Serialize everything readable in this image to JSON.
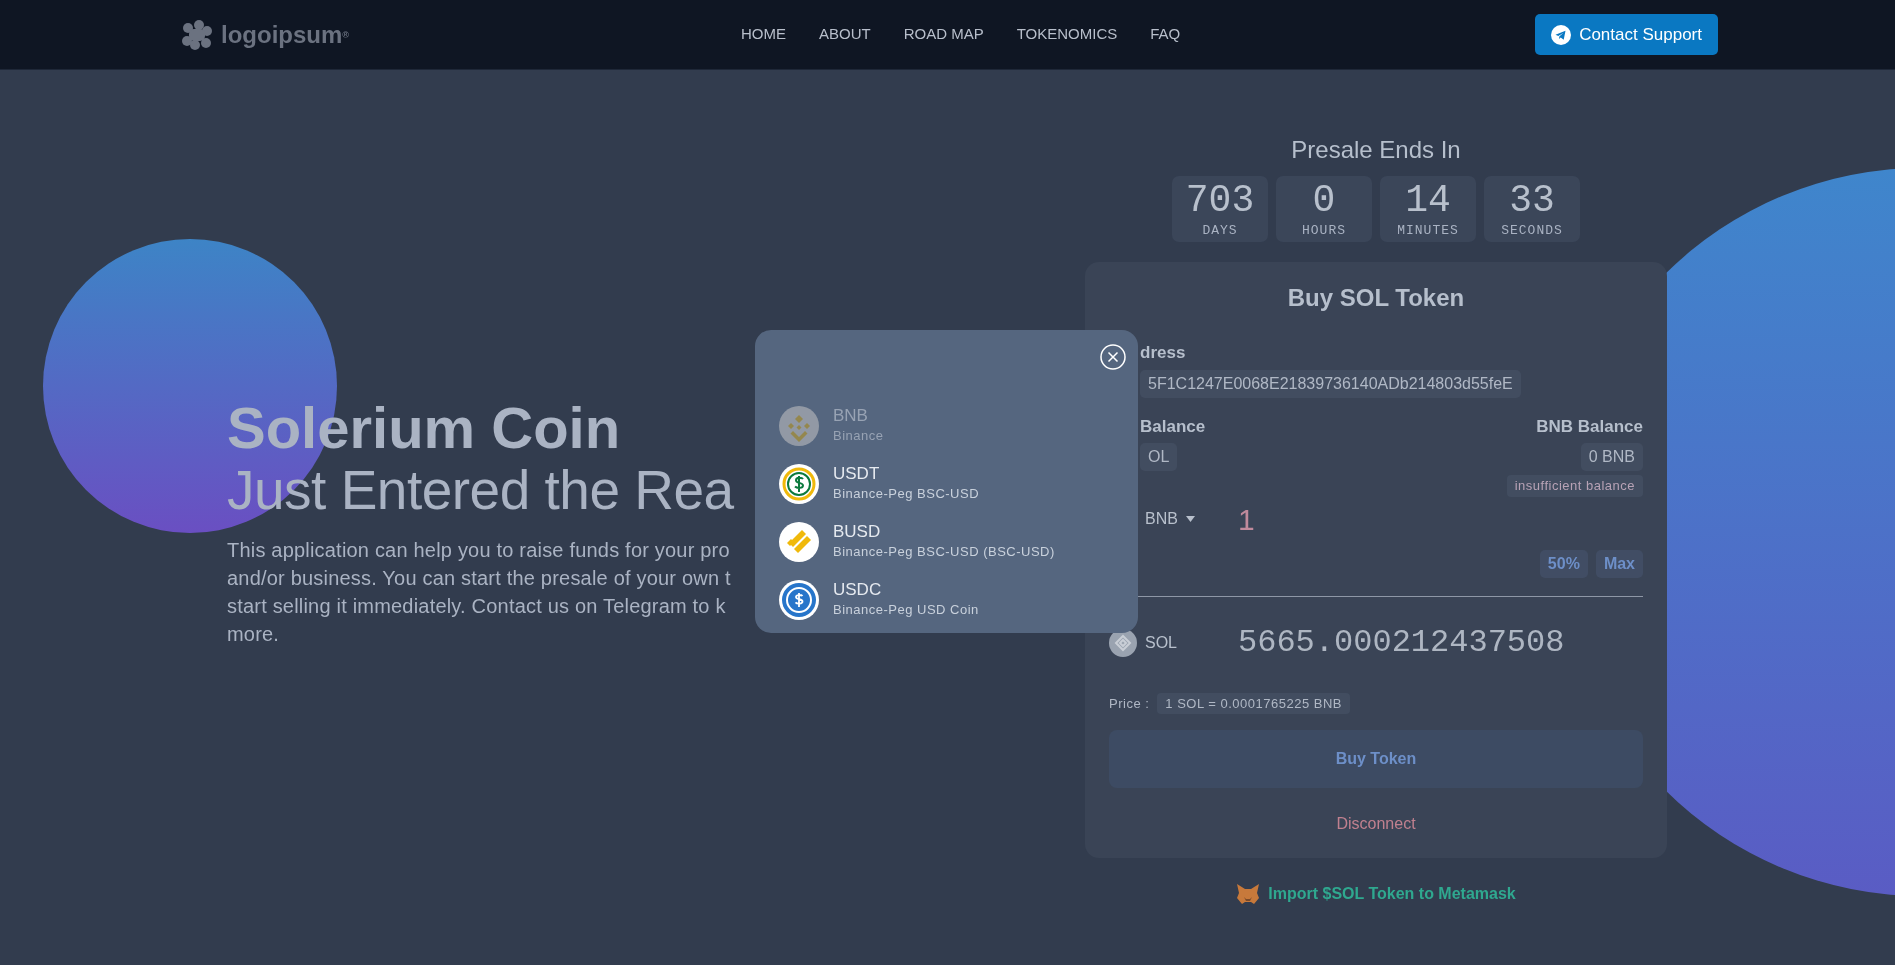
{
  "navbar": {
    "logo": "logoipsum$^{®}$",
    "links": [
      {
        "label": "HOME"
      },
      {
        "label": "ABOUT"
      },
      {
        "label": "ROAD MAP"
      },
      {
        "label": "TOKENOMICS"
      },
      {
        "label": "FAQ"
      }
    ],
    "contact_button": "Contact Support"
  },
  "hero": {
    "title": "Solerium Coin",
    "subtitle": "Just Entered the Rea",
    "description_lines": [
      "This application can help you to raise funds for your pro",
      "and/or business. You can start the presale of your own t",
      "start selling it immediately. Contact us on Telegram to k",
      "more."
    ]
  },
  "presale": {
    "title": "Presale Ends In",
    "countdown": [
      {
        "value": "703",
        "unit": "DAYS"
      },
      {
        "value": "0",
        "unit": "HOURS"
      },
      {
        "value": "14",
        "unit": "MINUTES"
      },
      {
        "value": "33",
        "unit": "SECONDS"
      }
    ]
  },
  "buy_card": {
    "title": "Buy SOL Token",
    "address_label": "dress",
    "address": "5F1C1247E0068E21839736140ADb214803d55feE",
    "sol_balance_label": "Balance",
    "sol_balance": "OL",
    "bnb_balance_label": "BNB Balance",
    "bnb_balance": "0 BNB",
    "balance_warning": "insufficient balance",
    "pay_currency": "BNB",
    "pay_amount": "1",
    "quick_amounts": [
      "50%",
      "Max"
    ],
    "receive_currency": "SOL",
    "receive_amount": "5665.000212437508",
    "price_label": "Price :",
    "price": "1 SOL = 0.0001765225 BNB",
    "buy_button": "Buy Token",
    "disconnect": "Disconnect"
  },
  "import_link": "Import $SOL Token to Metamask",
  "token_modal": {
    "tokens": [
      {
        "kind": "bnb",
        "symbol": "BNB",
        "name": "Binance",
        "selected": true
      },
      {
        "kind": "usdt",
        "symbol": "USDT",
        "name": "Binance-Peg BSC-USD",
        "selected": false
      },
      {
        "kind": "busd",
        "symbol": "BUSD",
        "name": "Binance-Peg BSC-USD (BSC-USD)",
        "selected": false
      },
      {
        "kind": "usdc",
        "symbol": "USDC",
        "name": "Binance-Peg USD Coin",
        "selected": false
      }
    ]
  }
}
